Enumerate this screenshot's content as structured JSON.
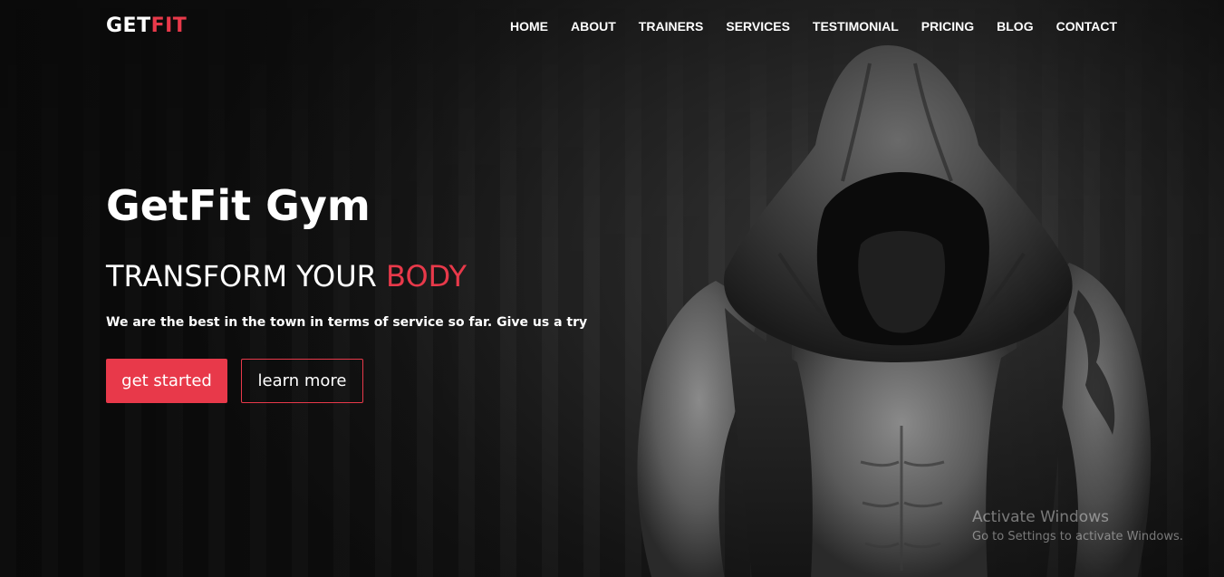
{
  "brand": {
    "part1": "GET",
    "part2": "FIT"
  },
  "nav": [
    "HOME",
    "ABOUT",
    "TRAINERS",
    "SERVICES",
    "TESTIMONIAL",
    "PRICING",
    "BLOG",
    "CONTACT"
  ],
  "hero": {
    "title": "GetFit Gym",
    "subtitle_part1": "TRANSFORM YOUR ",
    "subtitle_highlight": "BODY",
    "description": "We are the best in the town in terms of service so far. Give us a try",
    "primary_button": "get started",
    "secondary_button": "learn more"
  },
  "watermark": {
    "title": "Activate Windows",
    "subtitle": "Go to Settings to activate Windows."
  },
  "colors": {
    "accent": "#e8394a",
    "background": "#1c1c1c",
    "text": "#ffffff"
  }
}
